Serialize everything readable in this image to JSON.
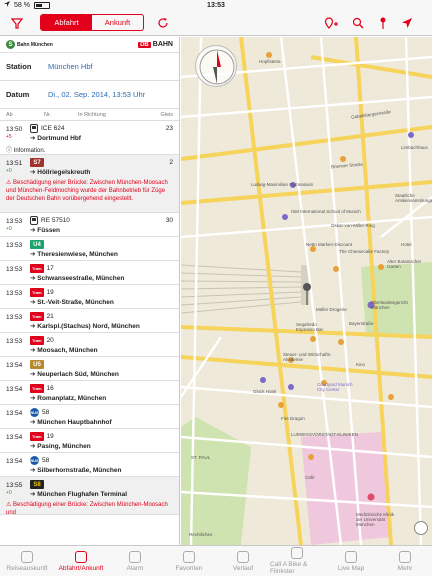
{
  "status": {
    "carrier": "iPad",
    "time": "13:53",
    "battery": "58 %"
  },
  "nav": {
    "segments": [
      "Abfahrt",
      "Ankunft"
    ],
    "active_segment": 0
  },
  "brand": {
    "sbahn": "Bahn München",
    "db": "DB",
    "bahn": "BAHN"
  },
  "station": {
    "label": "Station",
    "value": "München Hbf"
  },
  "datum": {
    "label": "Datum",
    "value": "Di., 02. Sep. 2014, 13:53 Uhr"
  },
  "columns": {
    "ab": "Ab",
    "nr": "Nr.",
    "richtung": "In Richtung",
    "gleis": "Gleis"
  },
  "departures": [
    {
      "time": "13:50",
      "delay": "+5",
      "delay_color": "red",
      "line_type": "train",
      "line": "ICE 624",
      "dest": "Dortmund Hbf",
      "gleis": "23",
      "note": "Information."
    },
    {
      "time": "13:51",
      "delay": "+0",
      "line_type": "S7",
      "line": "S7",
      "dest": "Höllriegelskreuth",
      "gleis": "2",
      "warn": "Beschädigung einer Brücke: Zwischen München-Moosach und München-Feldmoching wurde der Bahnbetrieb für Züge der Deutschen Bahn vorübergehend eingestellt."
    },
    {
      "time": "13:53",
      "delay": "+0",
      "line_type": "train",
      "line": "RE 57510",
      "dest": "Füssen",
      "gleis": "30"
    },
    {
      "time": "13:53",
      "line_type": "U4",
      "line": "U4",
      "dest": "Theresienwiese, München"
    },
    {
      "time": "13:53",
      "line_type": "tram",
      "line": "17",
      "dest": "Schwanseestraße, München"
    },
    {
      "time": "13:53",
      "line_type": "tram",
      "line": "19",
      "dest": "St.-Veit-Straße, München"
    },
    {
      "time": "13:53",
      "line_type": "tram",
      "line": "21",
      "dest": "Karlspl.(Stachus) Nord, München"
    },
    {
      "time": "13:53",
      "line_type": "tram",
      "line": "20",
      "dest": "Moosach, München"
    },
    {
      "time": "13:54",
      "line_type": "U5",
      "line": "U5",
      "dest": "Neuperlach Süd, München"
    },
    {
      "time": "13:54",
      "line_type": "tram",
      "line": "16",
      "dest": "Romanplatz, München"
    },
    {
      "time": "13:54",
      "line_type": "bus",
      "line": "58",
      "dest": "München Hauptbahnhof"
    },
    {
      "time": "13:54",
      "line_type": "tram",
      "line": "19",
      "dest": "Pasing, München"
    },
    {
      "time": "13:54",
      "line_type": "bus",
      "line": "58",
      "dest": "Silberhornstraße, München"
    },
    {
      "time": "13:55",
      "delay": "+0",
      "line_type": "S8",
      "line": "S8",
      "dest": "München Flughafen Terminal",
      "warn": "Beschädigung einer Brücke: Zwischen München-Moosach und"
    }
  ],
  "map_labels": {
    "hopfisteria": "Hopfisteria",
    "gabelsberger": "Gabelsbergerstraße",
    "brienner": "Brienner Straße",
    "ludwig": "Ludwig-Maximilian Gymnasium",
    "limbach": "Limbachhaus",
    "schule": "ISM International School of Munich",
    "oskar": "Oskar-von-Miller-Ring",
    "koenigsplatz": "Königsplatz",
    "galerie": "Staatliche Antikensammlungen",
    "netto": "Netto Marken-Discount",
    "cheese": "The Cheesecake Factory",
    "hotel": "Hotel",
    "botanisch": "Alter Botanischer Garten",
    "sonnen": "Sonnenstraße",
    "oberlandes": "Oberlandesgericht München",
    "segafredo": "Segafredo Espresso Bar",
    "bayer": "Bayerstraße",
    "mueller": "Müller Drogerie",
    "kino": "Kino",
    "steuer": "Steuer- und Wirtschafts-Akademie",
    "courtyard": "Courtyard Munich City Center",
    "glueck": "Glück Hotel",
    "fire": "Fire Dragon",
    "stpauli": "ST. PAUL",
    "ludwigsvorstadt": "LUDWIGSVORSTADT-KLINIKEN",
    "cafe": "Café",
    "klinik": "Medizinische Klinik der Universität München",
    "pschorr": "Pschorrstraße",
    "legal": "Rechtliches"
  },
  "tabs": [
    "Reiseauskunft",
    "Abfahrt/Ankunft",
    "Alarm",
    "Favoriten",
    "Verlauf",
    "Call A Bike & Flinkster",
    "Live Map",
    "Mehr"
  ],
  "active_tab": 1
}
